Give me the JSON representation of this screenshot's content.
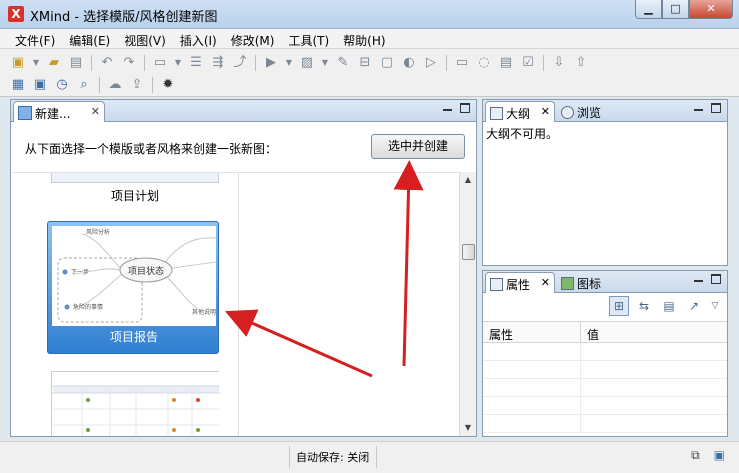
{
  "window": {
    "title": "XMind - 选择模版/风格创建新图",
    "app_icon_glyph": "X",
    "minimize_glyph": "▁",
    "maximize_glyph": "□",
    "close_glyph": "✕"
  },
  "menu": [
    {
      "label": "文件(F)"
    },
    {
      "label": "编辑(E)"
    },
    {
      "label": "视图(V)"
    },
    {
      "label": "插入(I)"
    },
    {
      "label": "修改(M)"
    },
    {
      "label": "工具(T)"
    },
    {
      "label": "帮助(H)"
    }
  ],
  "toolbar": {
    "row1": [
      "new-icon",
      "open-folder-icon",
      "save-icon",
      "undo-icon",
      "redo-icon",
      "topic-icon",
      "subtopic-icon",
      "floating-topic-icon",
      "relationship-icon",
      "marker-icon",
      "image-icon",
      "attachment-icon",
      "summary-icon",
      "boundary-icon",
      "style-icon",
      "presentation-icon",
      "notes-icon",
      "idea-icon",
      "outline-icon",
      "task-icon",
      "download-icon",
      "upload-icon"
    ],
    "row2": [
      "table-icon",
      "gallery-icon",
      "clock-icon",
      "search-icon",
      "cloud-icon",
      "share-icon",
      "settings-gear-icon"
    ]
  },
  "editor": {
    "tab_label": "新建...",
    "prompt": "从下面选择一个模版或者风格来创建一张新图：",
    "create_button": "选中并创建",
    "templates": [
      {
        "caption": "项目计划"
      },
      {
        "caption": "项目报告"
      }
    ],
    "mindmap_preview": {
      "center": "项目状态",
      "nodes": [
        "风险分析",
        "下一步",
        "危险的事情",
        "其他说明"
      ]
    }
  },
  "outline_panel": {
    "tabs": [
      "大纲",
      "浏览"
    ],
    "message": "大纲不可用。"
  },
  "properties_panel": {
    "tabs": [
      "属性",
      "图标"
    ],
    "columns": [
      "属性",
      "值"
    ]
  },
  "statusbar": {
    "autosave": "自动保存: 关闭"
  },
  "colors": {
    "accent": "#2f7fd2",
    "arrow": "#d62020",
    "titlebar": "#c4d9f0"
  }
}
